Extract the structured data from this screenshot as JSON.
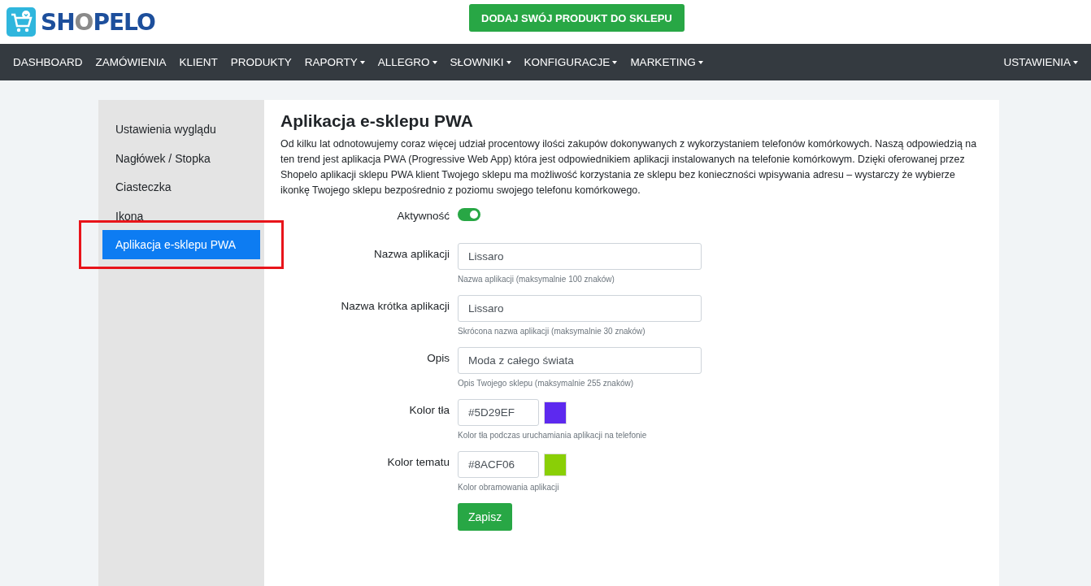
{
  "logo": {
    "parts": [
      {
        "text": "SH",
        "kind": "main"
      },
      {
        "text": "O",
        "kind": "accent"
      },
      {
        "text": "PELO",
        "kind": "main"
      }
    ]
  },
  "promo_button": "DODAJ SWÓJ PRODUKT DO SKLEPU",
  "nav": {
    "items": [
      {
        "label": "DASHBOARD",
        "dropdown": false
      },
      {
        "label": "ZAMÓWIENIA",
        "dropdown": false
      },
      {
        "label": "KLIENT",
        "dropdown": false
      },
      {
        "label": "PRODUKTY",
        "dropdown": false
      },
      {
        "label": "RAPORTY",
        "dropdown": true
      },
      {
        "label": "ALLEGRO",
        "dropdown": true
      },
      {
        "label": "SŁOWNIKI",
        "dropdown": true
      },
      {
        "label": "KONFIGURACJE",
        "dropdown": true
      },
      {
        "label": "MARKETING",
        "dropdown": true
      }
    ],
    "right": {
      "label": "USTAWIENIA",
      "dropdown": true
    }
  },
  "sidebar": {
    "items": [
      {
        "label": "Ustawienia wyglądu",
        "selected": false,
        "outlined": false
      },
      {
        "label": "Nagłówek / Stopka",
        "selected": false,
        "outlined": false
      },
      {
        "label": "Ciasteczka",
        "selected": false,
        "outlined": false
      },
      {
        "label": "Ikona",
        "selected": false,
        "outlined": false
      },
      {
        "label": "Aplikacja e-sklepu PWA",
        "selected": true,
        "outlined": true
      }
    ]
  },
  "content": {
    "title": "Aplikacja e-sklepu PWA",
    "description": "Od kilku lat odnotowujemy coraz więcej udział procentowy ilości zakupów dokonywanych z wykorzystaniem telefonów komórkowych. Naszą odpowiedzią na ten trend jest aplikacja PWA (Progressive Web App) która jest odpowiednikiem aplikacji instalowanych na telefonie komórkowym. Dzięki oferowanej przez Shopelo aplikacji sklepu PWA klient Twojego sklepu ma możliwość korzystania ze sklepu bez konieczności wpisywania adresu – wystarczy że wybierze ikonkę Twojego sklepu bezpośrednio z poziomu swojego telefonu komórkowego.",
    "fields": [
      {
        "kind": "toggle",
        "label": "Aktywność",
        "on": true
      },
      {
        "kind": "text",
        "label": "Nazwa aplikacji",
        "value": "Lissaro",
        "help": "Nazwa aplikacji (maksymalnie 100 znaków)"
      },
      {
        "kind": "text",
        "label": "Nazwa krótka aplikacji",
        "value": "Lissaro",
        "help": "Skrócona nazwa aplikacji (maksymalnie 30 znaków)"
      },
      {
        "kind": "text",
        "label": "Opis",
        "value": "Moda z całego świata",
        "help": "Opis Twojego sklepu (maksymalnie 255 znaków)"
      },
      {
        "kind": "color",
        "label": "Kolor tła",
        "value": "#5D29EF",
        "color": "#5d29ef",
        "help": "Kolor tła podczas uruchamiania aplikacji na telefonie"
      },
      {
        "kind": "color",
        "label": "Kolor tematu",
        "value": "#8ACF06",
        "color": "#8acf06",
        "help": "Kolor obramowania aplikacji"
      }
    ],
    "save_button": "Zapisz"
  }
}
